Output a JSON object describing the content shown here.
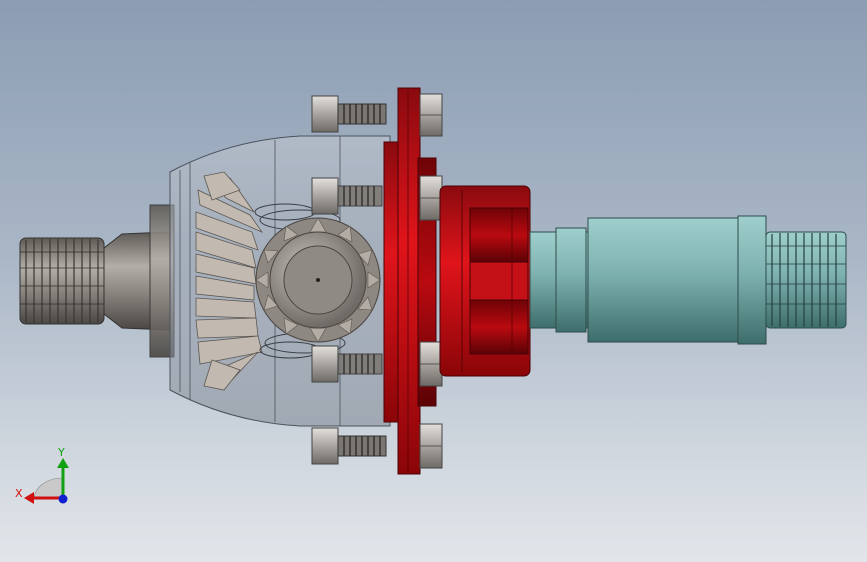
{
  "viewport": {
    "background_top": "#8c9db3",
    "background_bottom": "#e2e6ea"
  },
  "model": {
    "parts": {
      "left_shaft_color": "#8a8680",
      "housing_color": "#a8adb5",
      "bevel_gear_color": "#b9b1a8",
      "bolt_color": "#c9c5c0",
      "flange_color": "#d0141a",
      "hub_color": "#b0060b",
      "right_shaft_color": "#7fb4b2",
      "spline_color": "#6e9e9c"
    }
  },
  "triad": {
    "x_label": "X",
    "y_label": "Y",
    "x_color": "#d01010",
    "y_color": "#10a010",
    "z_color": "#1020d0"
  }
}
